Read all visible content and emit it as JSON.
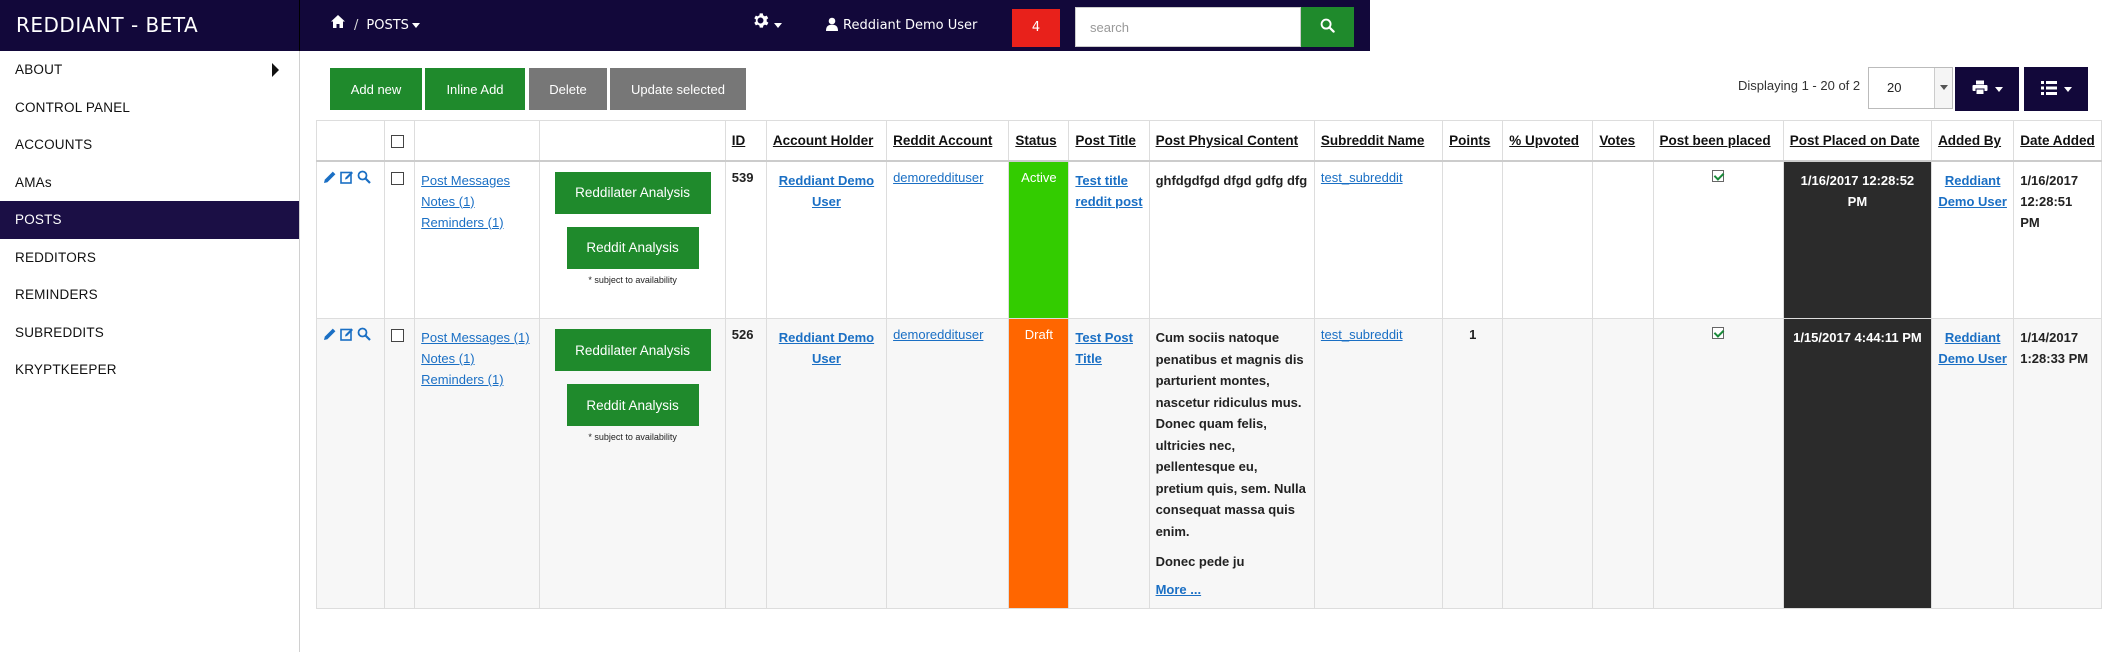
{
  "app": {
    "title": "REDDIANT - BETA"
  },
  "breadcrumb": {
    "home_icon": "home-icon",
    "separator": "/",
    "current": "POSTS"
  },
  "header": {
    "settings_icon": "gear-icon",
    "user_icon": "user-icon",
    "user_name": "Reddiant Demo User",
    "notification_count": "4",
    "search_placeholder": "search",
    "search_icon": "search-icon"
  },
  "sidebar": {
    "items": [
      {
        "label": "ABOUT"
      },
      {
        "label": "CONTROL PANEL"
      },
      {
        "label": "ACCOUNTS"
      },
      {
        "label": "AMAs"
      },
      {
        "label": "POSTS"
      },
      {
        "label": "REDDITORS"
      },
      {
        "label": "REMINDERS"
      },
      {
        "label": "SUBREDDITS"
      },
      {
        "label": "KRYPTKEEPER"
      }
    ],
    "active": "POSTS"
  },
  "toolbar": {
    "add_new": "Add new",
    "inline_add": "Inline Add",
    "delete": "Delete",
    "update_selected": "Update selected",
    "displaying": "Displaying 1 - 20 of 2",
    "per_page": "20",
    "print_icon": "print-icon",
    "columns_icon": "list-icon"
  },
  "table": {
    "headers": {
      "id": "ID",
      "account_holder": "Account Holder",
      "reddit_account": "Reddit Account",
      "status": "Status",
      "post_title": "Post Title",
      "post_physical_content": "Post Physical Content",
      "subreddit_name": "Subreddit Name",
      "points": "Points",
      "pct_upvoted": "% Upvoted",
      "votes": "Votes",
      "post_been_placed": "Post been placed",
      "post_placed_on_date": "Post Placed on Date",
      "added_by": "Added By",
      "date_added": "Date Added"
    },
    "analysis": {
      "reddilater": "Reddilater Analysis",
      "reddit": "Reddit Analysis",
      "note": "* subject to availability"
    },
    "rows": [
      {
        "link_messages": "Post Messages",
        "link_notes": "Notes (1)",
        "link_reminders": "Reminders (1)",
        "id": "539",
        "account_holder": "Reddiant Demo User",
        "reddit_account": "demoreddituser",
        "status": "Active",
        "post_title": "Test title reddit post",
        "content": "ghfdgdfgd dfgd gdfg dfg",
        "more": "",
        "subreddit": "test_subreddit",
        "points": "",
        "pct_upvoted": "",
        "votes": "",
        "placed": true,
        "placed_date": "1/16/2017 12:28:52 PM",
        "added_by": "Reddiant Demo User",
        "date_added": "1/16/2017 12:28:51 PM"
      },
      {
        "link_messages": "Post Messages (1)",
        "link_notes": "Notes (1)",
        "link_reminders": "Reminders (1)",
        "id": "526",
        "account_holder": "Reddiant Demo User",
        "reddit_account": "demoreddituser",
        "status": "Draft",
        "post_title": "Test Post Title",
        "content": "Cum sociis natoque penatibus et magnis dis parturient montes, nascetur ridiculus mus. Donec quam felis, ultricies nec, pellentesque eu, pretium quis, sem. Nulla consequat massa quis enim.",
        "content_2": "Donec pede ju",
        "more": "More ...",
        "subreddit": "test_subreddit",
        "points": "1",
        "pct_upvoted": "",
        "votes": "",
        "placed": true,
        "placed_date": "1/15/2017 4:44:11 PM",
        "added_by": "Reddiant Demo User",
        "date_added": "1/14/2017 1:28:33 PM"
      }
    ]
  },
  "colors": {
    "navbar": "#12083a",
    "green": "#1f8a2c",
    "gray": "#777777",
    "active": "#33cc00",
    "draft": "#ff6600",
    "notification": "#e8211b",
    "dark_cell": "#2b2b2b"
  }
}
